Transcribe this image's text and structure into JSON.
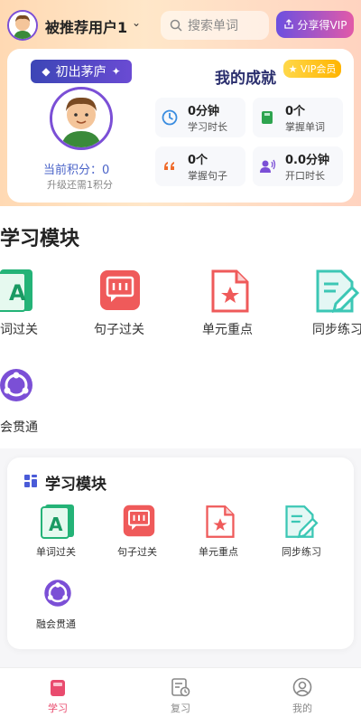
{
  "header": {
    "username": "被推荐用户1",
    "search_placeholder": "搜索单词",
    "vip_button": "分享得VIP"
  },
  "profile": {
    "badge": "初出茅庐",
    "points_label": "当前积分：0",
    "upgrade_hint": "升级还需1积分",
    "achievements_title": "我的成就",
    "vip_tag": "★ VIP会员",
    "stats": [
      {
        "value": "0分钟",
        "label": "学习时长",
        "icon": "clock-icon"
      },
      {
        "value": "0个",
        "label": "掌握单词",
        "icon": "book-icon"
      },
      {
        "value": "0个",
        "label": "掌握句子",
        "icon": "quote-icon"
      },
      {
        "value": "0.0分钟",
        "label": "开口时长",
        "icon": "speak-icon"
      }
    ]
  },
  "modules_large": {
    "title": "学习模块",
    "items": [
      {
        "label": "词过关",
        "icon": "word-card-icon"
      },
      {
        "label": "句子过关",
        "icon": "sentence-icon"
      },
      {
        "label": "单元重点",
        "icon": "unit-key-icon"
      },
      {
        "label": "同步练习",
        "icon": "practice-icon"
      },
      {
        "label": "会贯通",
        "icon": "integrate-icon"
      }
    ]
  },
  "modules_small": {
    "title": "学习模块",
    "items": [
      {
        "label": "单词过关",
        "icon": "word-card-icon"
      },
      {
        "label": "句子过关",
        "icon": "sentence-icon"
      },
      {
        "label": "单元重点",
        "icon": "unit-key-icon"
      },
      {
        "label": "同步练习",
        "icon": "practice-icon"
      },
      {
        "label": "融会贯通",
        "icon": "integrate-icon"
      }
    ]
  },
  "bottom_nav": {
    "items": [
      {
        "label": "学习",
        "active": true
      },
      {
        "label": "复习",
        "active": false
      },
      {
        "label": "我的",
        "active": false
      }
    ]
  },
  "colors": {
    "accent_purple": "#7b4fd6",
    "active_nav": "#e94b6e",
    "green": "#24b377",
    "red": "#ef5a5a",
    "teal": "#3cc7b5"
  }
}
